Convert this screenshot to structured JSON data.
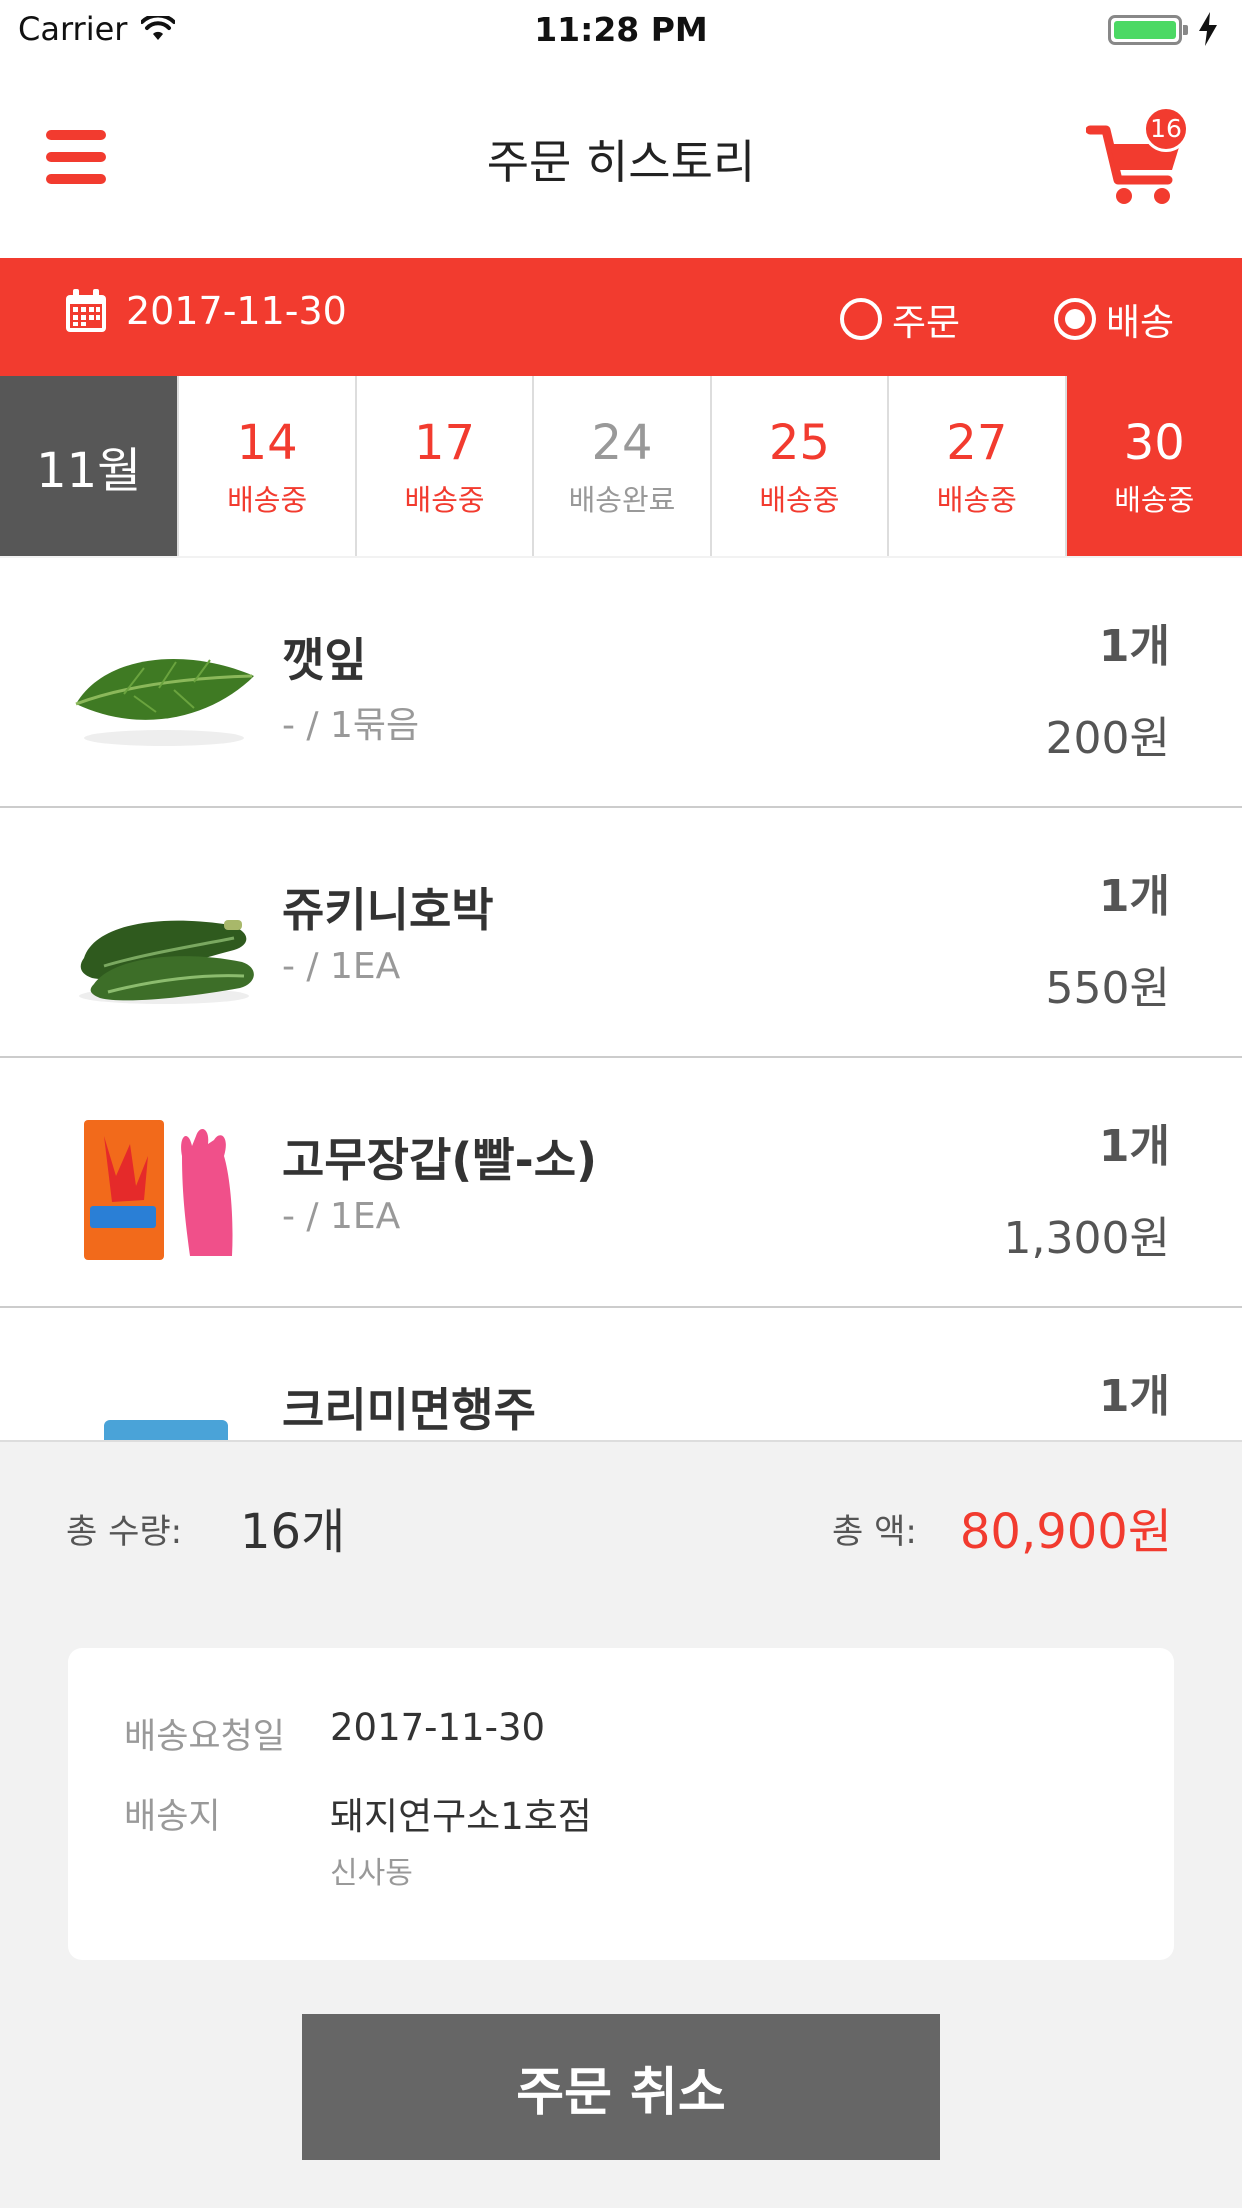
{
  "status_bar": {
    "carrier": "Carrier",
    "time": "11:28 PM"
  },
  "header": {
    "title": "주문 히스토리",
    "cart_count": "16"
  },
  "date_bar": {
    "date": "2017-11-30",
    "radio_order": "주문",
    "radio_delivery": "배송",
    "selected": "배송"
  },
  "date_strip": {
    "month": "11월",
    "days": [
      {
        "day": "14",
        "status": "배송중"
      },
      {
        "day": "17",
        "status": "배송중"
      },
      {
        "day": "24",
        "status": "배송완료"
      },
      {
        "day": "25",
        "status": "배송중"
      },
      {
        "day": "27",
        "status": "배송중"
      },
      {
        "day": "30",
        "status": "배송중"
      }
    ],
    "selected_day": "30"
  },
  "items": [
    {
      "name": "깻잎",
      "spec": "- / 1묶음",
      "qty": "1개",
      "price": "200원",
      "image": "perilla-leaf"
    },
    {
      "name": "쥬키니호박",
      "spec": "- / 1EA",
      "qty": "1개",
      "price": "550원",
      "image": "zucchini"
    },
    {
      "name": "고무장갑(빨-소)",
      "spec": "- / 1EA",
      "qty": "1개",
      "price": "1,300원",
      "image": "rubber-gloves"
    },
    {
      "name": "크리미면행주",
      "spec": "",
      "qty": "1개",
      "price": "",
      "image": "cotton-dishcloth"
    }
  ],
  "summary": {
    "qty_label": "총 수량:",
    "qty_value": "16개",
    "amount_label": "총 액:",
    "amount_value": "80,900원"
  },
  "delivery_info": {
    "request_date_label": "배송요청일",
    "request_date_value": "2017-11-30",
    "address_label": "배송지",
    "address_name": "돼지연구소1호점",
    "address_detail": "신사동"
  },
  "cancel_button": "주문 취소",
  "colors": {
    "accent": "#f23b2f",
    "dark_gray": "#575757",
    "button_gray": "#666666"
  }
}
